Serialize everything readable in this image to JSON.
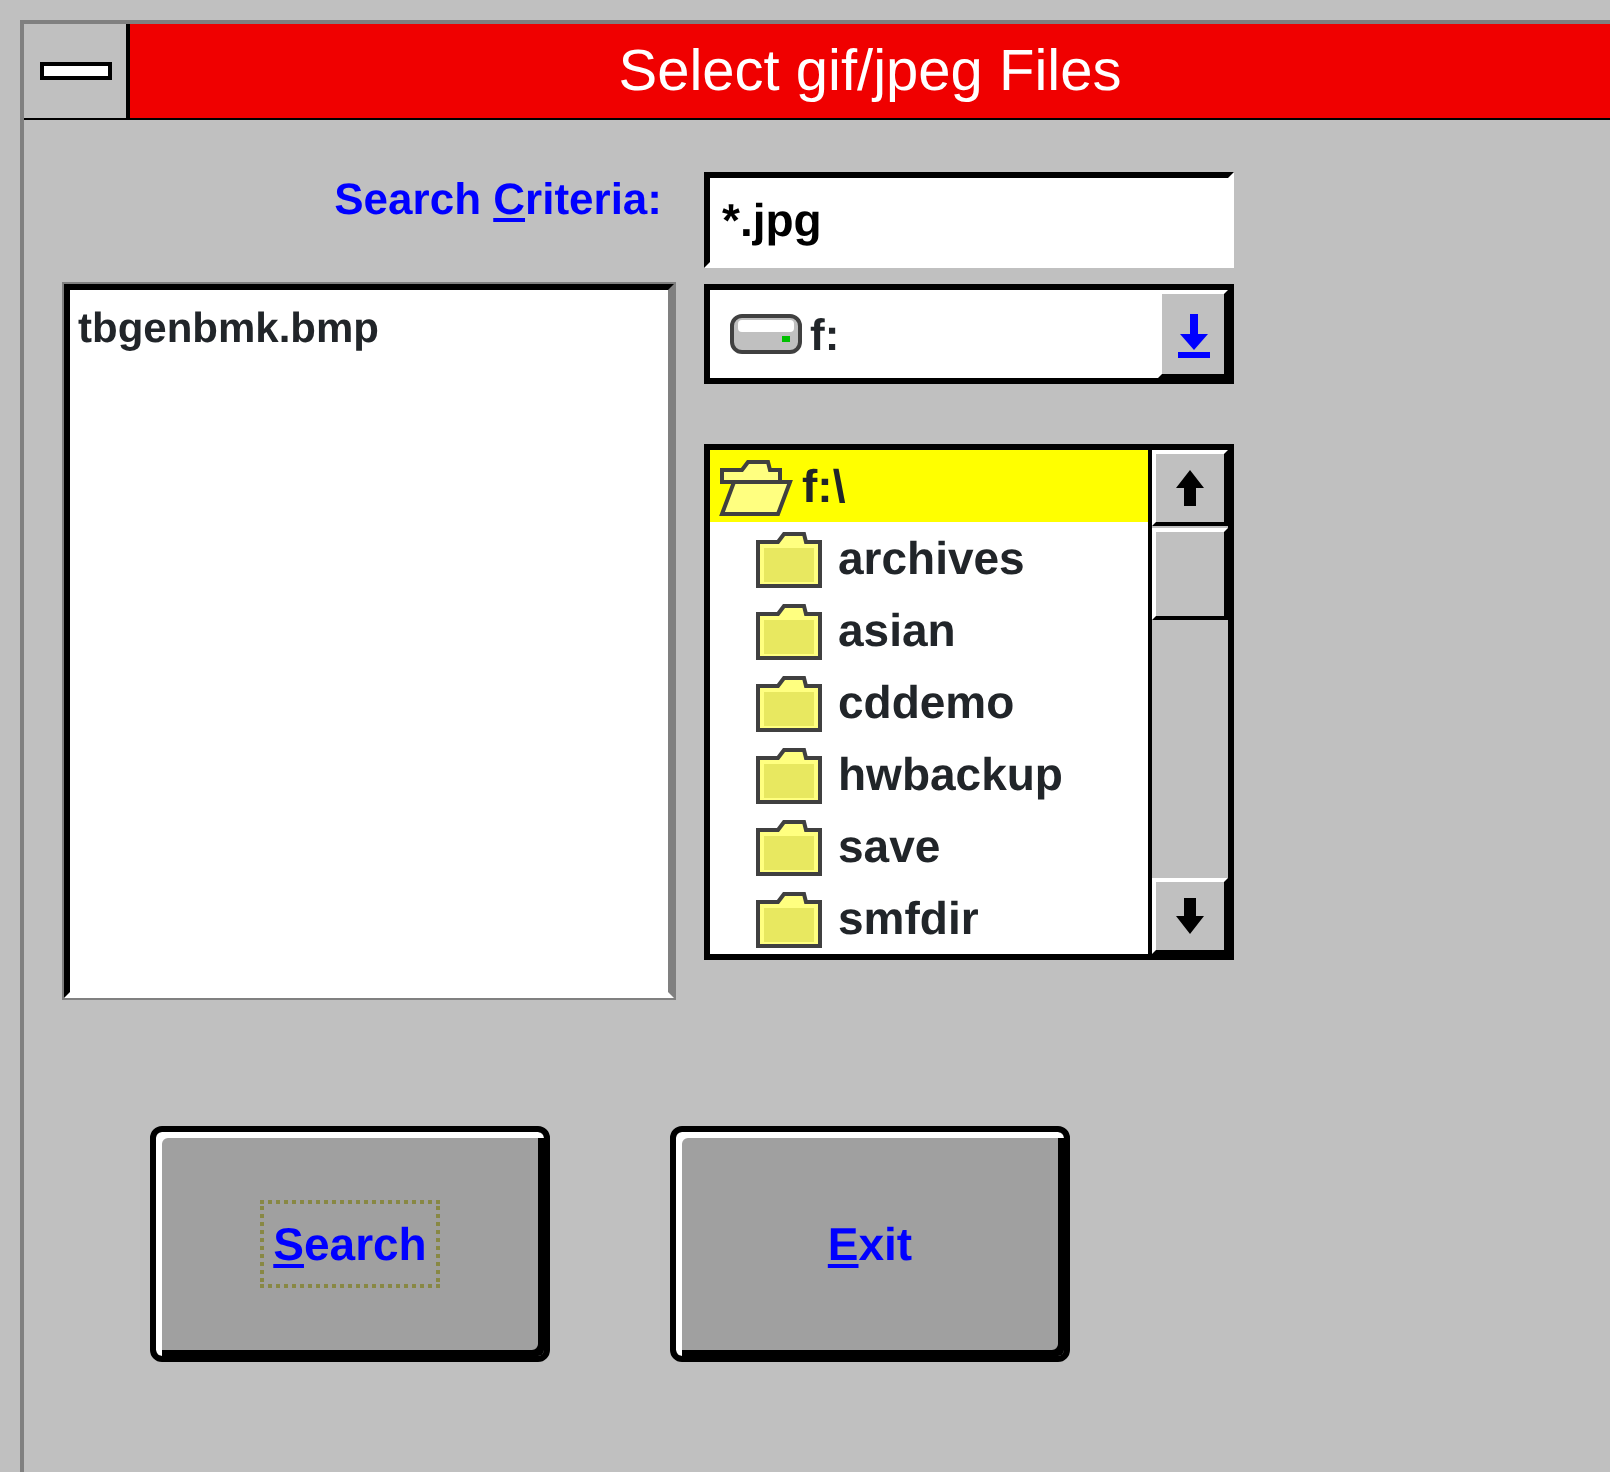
{
  "window": {
    "title": "Select gif/jpeg Files"
  },
  "search_criteria": {
    "label_parts": [
      "Search ",
      "C",
      "riteria:"
    ],
    "value": "*.jpg"
  },
  "file_list": {
    "items": [
      {
        "label": "tbgenbmk.bmp",
        "selected": false
      }
    ]
  },
  "drive": {
    "value": "f:"
  },
  "directories": [
    {
      "label": "f:\\",
      "selected": true,
      "open": true,
      "children": [
        {
          "label": "archives",
          "selected": false,
          "open": false
        },
        {
          "label": "asian",
          "selected": false,
          "open": false
        },
        {
          "label": "cddemo",
          "selected": false,
          "open": false
        },
        {
          "label": "hwbackup",
          "selected": false,
          "open": false
        },
        {
          "label": "save",
          "selected": false,
          "open": false
        },
        {
          "label": "smfdir",
          "selected": false,
          "open": false
        }
      ]
    }
  ],
  "buttons": [
    {
      "label_key": "S",
      "label_rest": "earch",
      "focused": true
    },
    {
      "label_key": "E",
      "label_rest": "xit",
      "focused": false
    }
  ]
}
